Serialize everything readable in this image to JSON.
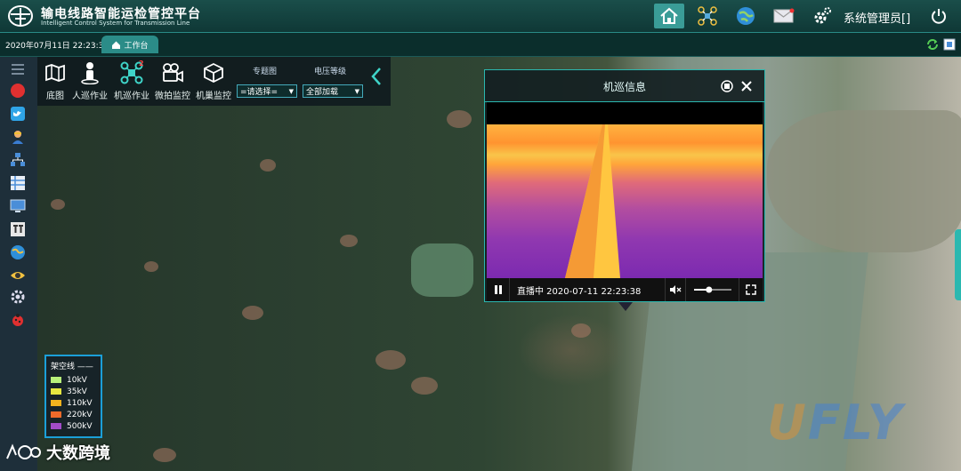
{
  "app": {
    "title_cn": "输电线路智能运检管控平台",
    "title_en": "Intelligent Control System for Transmission Line",
    "user": "系统管理员[]"
  },
  "header_icons": [
    "home-icon",
    "drone-icon",
    "globe-icon",
    "mail-icon",
    "settings-icon",
    "power-icon"
  ],
  "subbar": {
    "datetime": "2020年07月11日 22:23:38",
    "tab_label": "工作台"
  },
  "toolbar": {
    "tools": [
      {
        "label": "底图",
        "icon": "map-icon"
      },
      {
        "label": "人巡作业",
        "icon": "person-icon"
      },
      {
        "label": "机巡作业",
        "icon": "drone-icon",
        "badge": "2"
      },
      {
        "label": "微拍监控",
        "icon": "camera-icon"
      },
      {
        "label": "机巢监控",
        "icon": "box-icon"
      }
    ],
    "topic_label": "专题图",
    "topic_select": "=请选择=",
    "voltage_label": "电压等级",
    "voltage_select": "全部加载"
  },
  "legend": {
    "title": "架空线",
    "items": [
      {
        "label": "10kV",
        "color": "#b8f07a"
      },
      {
        "label": "35kV",
        "color": "#e6e640"
      },
      {
        "label": "110kV",
        "color": "#f2b21e"
      },
      {
        "label": "220kV",
        "color": "#ee6a2a"
      },
      {
        "label": "500kV",
        "color": "#a24cc8"
      }
    ]
  },
  "popup": {
    "title": "机巡信息",
    "status": "直播中 2020-07-11 22:23:38",
    "volume_percent": 40
  },
  "watermarks": {
    "bottom": "大数跨境"
  }
}
